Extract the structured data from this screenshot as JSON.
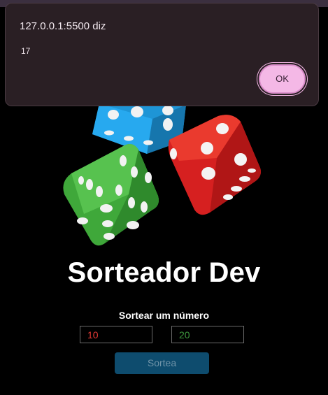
{
  "page": {
    "title": "Sorteador Dev",
    "subtitle": "Sortear um número",
    "min_value": "10",
    "max_value": "20",
    "button_label": "Sortea"
  },
  "dialog": {
    "origin": "127.0.0.1:5500 diz",
    "message": "17",
    "ok_label": "OK"
  },
  "colors": {
    "background": "#000000",
    "dialog_bg": "#2a1f24",
    "ok_button": "#f4b8e6",
    "button_bg": "#0e4c6e",
    "min_text": "#e53935",
    "max_text": "#3f9a3f"
  },
  "image": {
    "icon": "dice-image"
  }
}
